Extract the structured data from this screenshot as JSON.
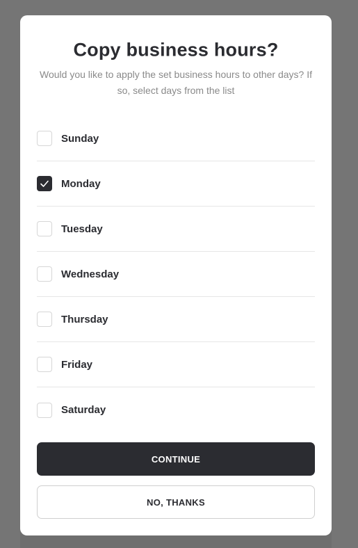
{
  "modal": {
    "title": "Copy business hours?",
    "subtitle": "Would you like to apply the set business hours to other days? If so, select days from the list"
  },
  "days": [
    {
      "label": "Sunday",
      "checked": false
    },
    {
      "label": "Monday",
      "checked": true
    },
    {
      "label": "Tuesday",
      "checked": false
    },
    {
      "label": "Wednesday",
      "checked": false
    },
    {
      "label": "Thursday",
      "checked": false
    },
    {
      "label": "Friday",
      "checked": false
    },
    {
      "label": "Saturday",
      "checked": false
    }
  ],
  "buttons": {
    "continue_label": "CONTINUE",
    "decline_label": "NO, THANKS"
  },
  "colors": {
    "overlay": "#757575",
    "primary": "#2b2c31",
    "subtitle_text": "#8a8a8a",
    "divider": "#e6e6e6"
  },
  "icons": {
    "checkbox_checked": "checkmark-icon"
  }
}
